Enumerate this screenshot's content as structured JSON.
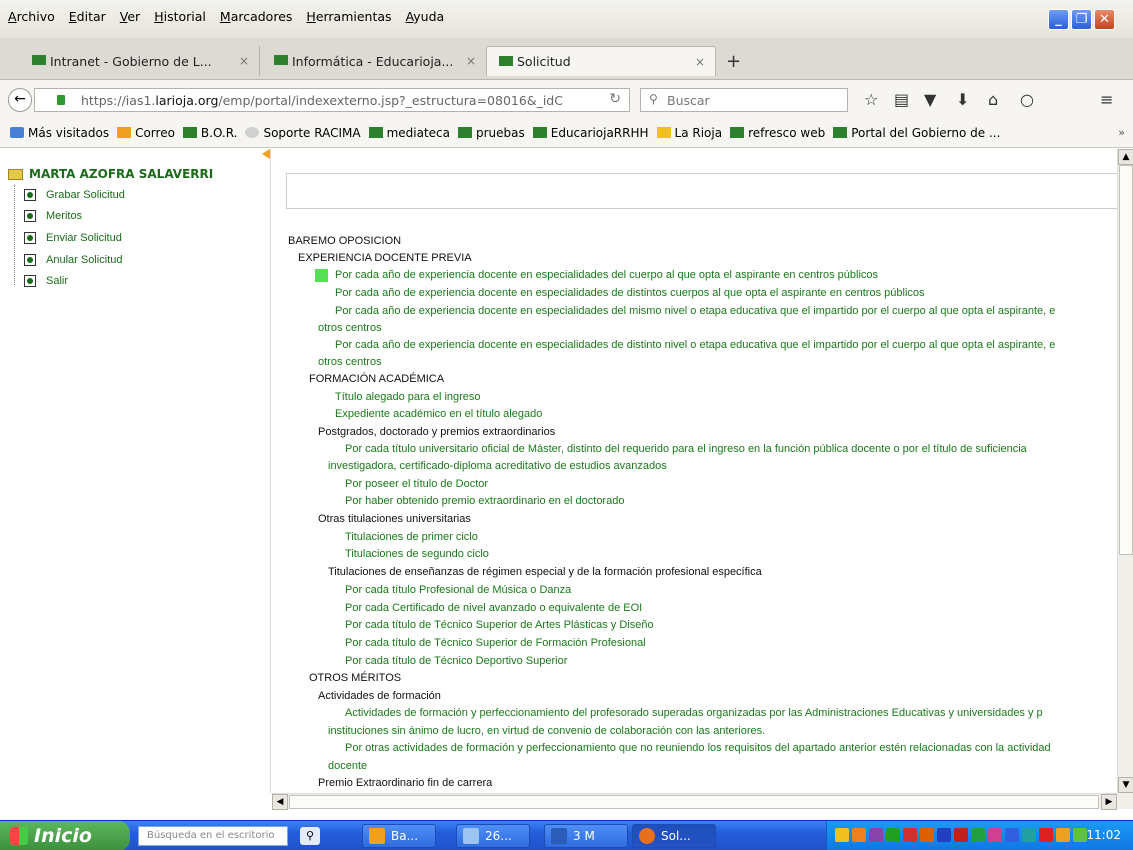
{
  "menu": [
    "Archivo",
    "Editar",
    "Ver",
    "Historial",
    "Marcadores",
    "Herramientas",
    "Ayuda"
  ],
  "tabs": [
    {
      "label": "Intranet - Gobierno de L...",
      "close": "×"
    },
    {
      "label": "Informática - Educarioja...",
      "close": "×"
    },
    {
      "label": "Solicitud",
      "close": "×"
    }
  ],
  "new_tab": "+",
  "address": {
    "prefix": "https://ias1.",
    "domain": "larioja.org",
    "rest": "/emp/portal/indexexterno.jsp?_estructura=08016&_idC"
  },
  "search": {
    "placeholder": "Buscar"
  },
  "bookmarks": [
    "Más visitados",
    "Correo",
    "B.O.R.",
    "Soporte RACIMA",
    "mediateca",
    "pruebas",
    "EducariojaRRHH",
    "La Rioja",
    "refresco web",
    "Portal del Gobierno de ..."
  ],
  "bookmark_more": "»",
  "sidebar": {
    "user": "MARTA AZOFRA SALAVERRI",
    "items": [
      "Grabar Solicitud",
      "Meritos",
      "Enviar Solicitud",
      "Anular Solicitud",
      "Salir"
    ]
  },
  "baremo": {
    "title": "BAREMO OPOSICION",
    "exp_header": "EXPERIENCIA DOCENTE PREVIA",
    "exp": [
      "Por cada año de experiencia docente en especialidades del cuerpo al que opta el aspirante en centros públicos",
      "Por cada año de experiencia docente en especialidades de distintos cuerpos al que opta el aspirante en centros públicos",
      "Por cada año de experiencia docente en especialidades del mismo nivel o etapa educativa que el impartido por el cuerpo al que opta el aspirante, e",
      "otros centros",
      "Por cada año de experiencia docente en especialidades de distinto nivel o etapa educativa que el impartido por el cuerpo al que opta el aspirante, e",
      "otros centros"
    ],
    "form_header": "FORMACIÓN ACADÉMICA",
    "form": [
      "Título alegado para el ingreso",
      "Expediente académico en el título alegado"
    ],
    "post_header": "Postgrados, doctorado y premios extraordinarios",
    "post": [
      "Por cada título universitario oficial de Máster, distinto del requerido para el ingreso en la función pública docente o por el título de suficiencia",
      "investigadora, certificado-diploma acreditativo de estudios avanzados",
      "Por poseer el título de Doctor",
      "Por haber obtenido premio extraordinario en el doctorado"
    ],
    "otras_header": "Otras titulaciones universitarias",
    "otras": [
      "Titulaciones de primer ciclo",
      "Titulaciones de segundo ciclo"
    ],
    "tit_header": "Titulaciones de enseñanzas de régimen especial y de la formación profesional específica",
    "tit": [
      "Por cada título Profesional de Música o Danza",
      "Por cada Certificado de nivel avanzado o equivalente de EOI",
      "Por cada título de Técnico Superior de Artes Plásticas y Diseño",
      "Por cada título de Técnico Superior de Formación Profesional",
      "Por cada título de Técnico Deportivo Superior"
    ],
    "otros_header": "OTROS MÉRITOS",
    "act_header": "Actividades de formación",
    "act": [
      "Actividades de formación y perfeccionamiento del profesorado superadas organizadas por las Administraciones Educativas y universidades y p",
      "instituciones sin ánimo de lucro, en virtud de convenio de colaboración con las anteriores.",
      "Por otras actividades de formación y perfeccionamiento que no reuniendo los requisitos del apartado anterior estén relacionadas con la actividad",
      "docente"
    ],
    "premio_header": "Premio Extraordinario fin de carrera"
  },
  "taskbar": {
    "start": "Inicio",
    "search_placeholder": "Búsqueda en el escritorio",
    "buttons": [
      "Ba...",
      "26...",
      "3 M",
      "Sol..."
    ],
    "clock": "11:02"
  }
}
